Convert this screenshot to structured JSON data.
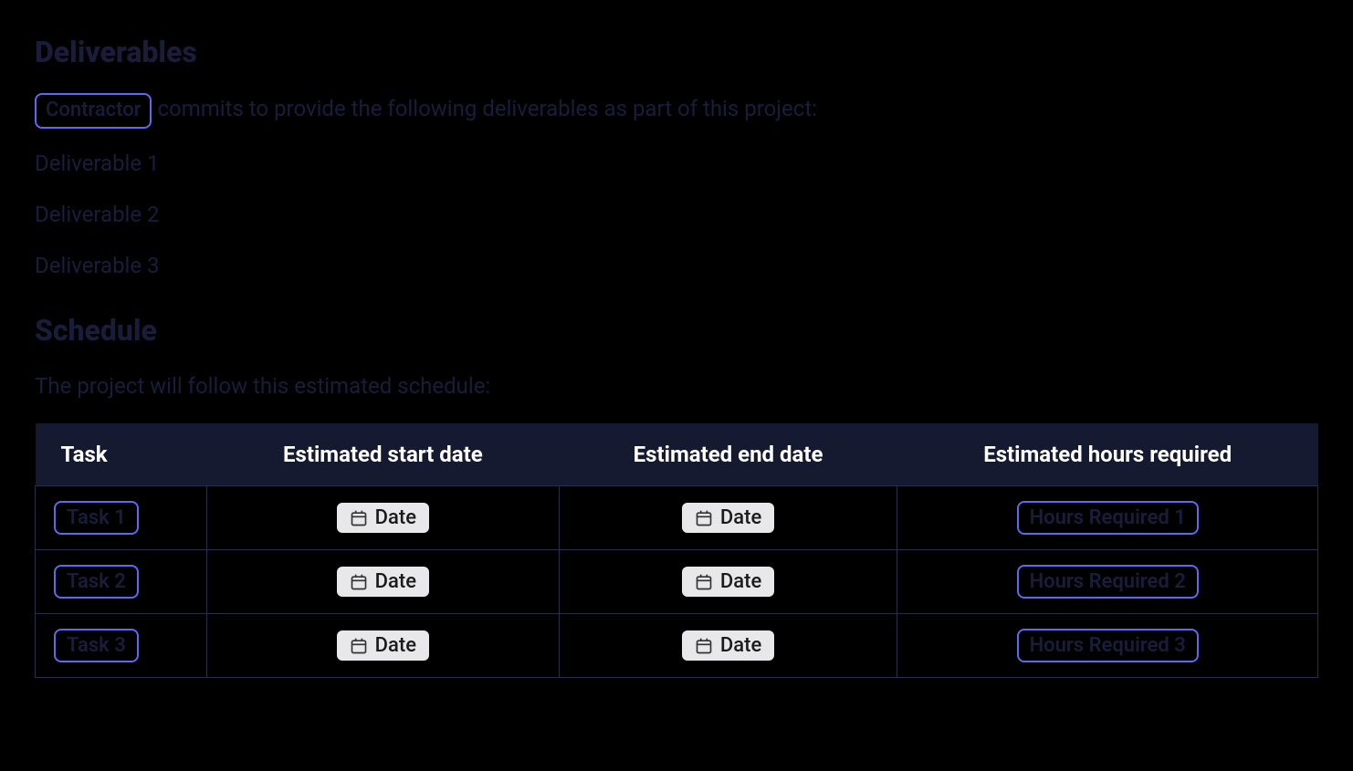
{
  "deliverables": {
    "heading": "Deliverables",
    "contractor_chip": "Contractor",
    "intro_text": " commits to provide the following deliverables as part of this project:",
    "items": [
      "Deliverable 1",
      "Deliverable 2",
      "Deliverable 3"
    ]
  },
  "schedule": {
    "heading": "Schedule",
    "intro_text": "The project will follow this estimated schedule:",
    "columns": {
      "task": "Task",
      "start": "Estimated start date",
      "end": "Estimated end date",
      "hours": "Estimated hours required"
    },
    "rows": [
      {
        "task": "Task 1",
        "start": "Date",
        "end": "Date",
        "hours": "Hours Required 1"
      },
      {
        "task": "Task 2",
        "start": "Date",
        "end": "Date",
        "hours": "Hours Required 2"
      },
      {
        "task": "Task 3",
        "start": "Date",
        "end": "Date",
        "hours": "Hours Required 3"
      }
    ]
  }
}
